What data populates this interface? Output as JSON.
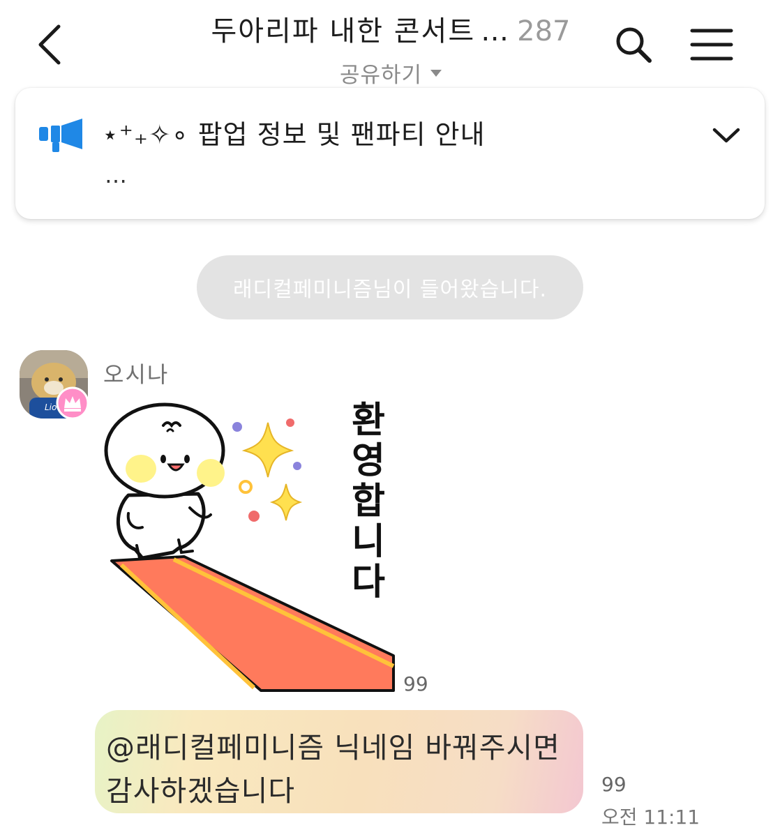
{
  "header": {
    "title": "두아리파 내한 콘서트",
    "title_ellipsis": "…",
    "member_count": "287",
    "share_label": "공유하기"
  },
  "notice": {
    "text": "⋆⁺₊✧∘ 팝업 정보 및 팬파티 안내",
    "more": "…"
  },
  "system_message": "래디컬페미니즘님이 들어왔습니다.",
  "message": {
    "sender": "오시나",
    "sticker_text": "환영합니다",
    "sticker_read_count": "99",
    "text_line1": "@래디컬페미니즘 닉네임 바꿔주시면",
    "text_line2": "감사하겠습니다",
    "text_read_count": "99",
    "time": "오전 11:11"
  },
  "colors": {
    "accent_blue": "#1f88e6",
    "system_bubble": "#e3e3e3",
    "crown_badge": "#ff8ec7",
    "carpet": "#ff7a5c",
    "carpet_stripe": "#ffc23a"
  },
  "icons": {
    "back": "chevron-left-icon",
    "search": "search-icon",
    "menu": "hamburger-menu-icon",
    "notice": "megaphone-icon",
    "toggle": "chevron-down-icon",
    "badge": "crown-icon"
  }
}
